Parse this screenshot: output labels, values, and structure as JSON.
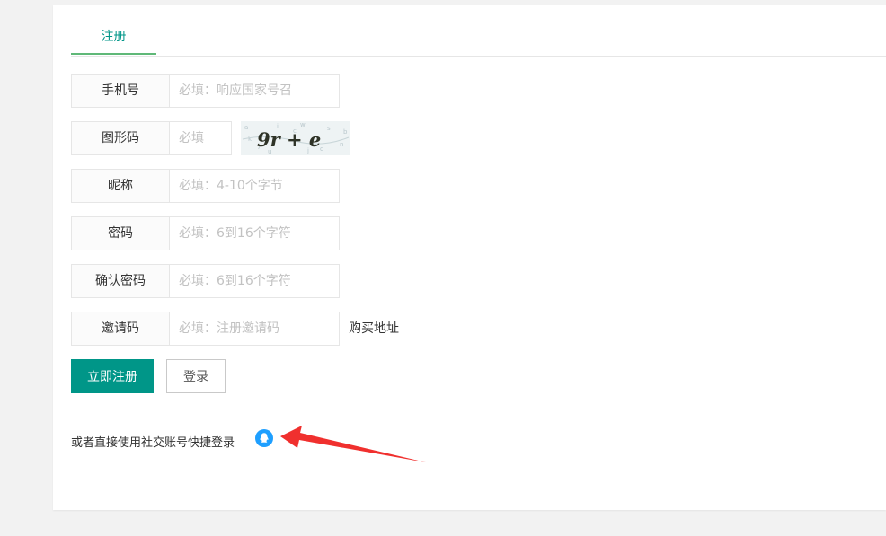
{
  "tabs": [
    {
      "label": "注册",
      "active": true
    }
  ],
  "form": {
    "phone": {
      "label": "手机号",
      "placeholder": "必填：响应国家号召"
    },
    "captcha": {
      "label": "图形码",
      "placeholder": "必填",
      "image_text": "9r + e"
    },
    "nickname": {
      "label": "昵称",
      "placeholder": "必填：4-10个字节"
    },
    "password": {
      "label": "密码",
      "placeholder": "必填：6到16个字符"
    },
    "confirm": {
      "label": "确认密码",
      "placeholder": "必填：6到16个字符"
    },
    "invite": {
      "label": "邀请码",
      "placeholder": "必填：注册邀请码",
      "buy_link": "购买地址"
    }
  },
  "buttons": {
    "register": "立即注册",
    "login": "登录"
  },
  "social": {
    "text": "或者直接使用社交账号快捷登录",
    "icon": "qq-icon"
  },
  "colors": {
    "accent": "#009688",
    "tab_underline": "#5FB878",
    "arrow": "#f0302e",
    "qq": "#1e9fff"
  }
}
